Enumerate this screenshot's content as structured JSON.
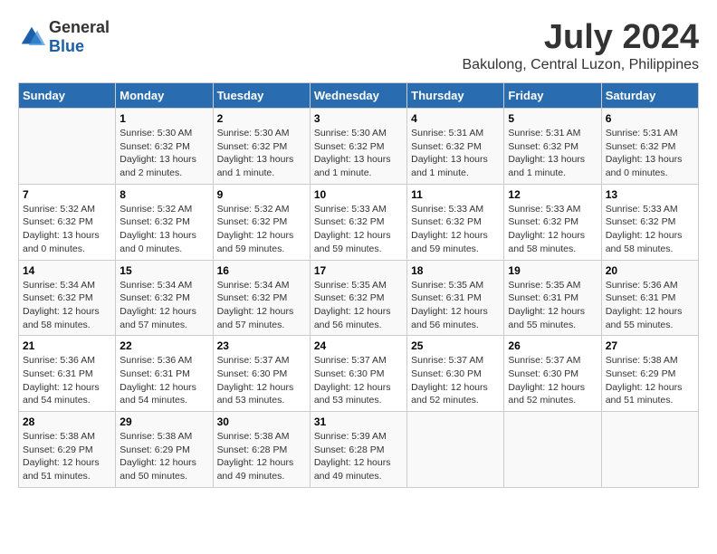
{
  "header": {
    "logo_general": "General",
    "logo_blue": "Blue",
    "title": "July 2024",
    "subtitle": "Bakulong, Central Luzon, Philippines"
  },
  "columns": [
    "Sunday",
    "Monday",
    "Tuesday",
    "Wednesday",
    "Thursday",
    "Friday",
    "Saturday"
  ],
  "weeks": [
    {
      "days": [
        {
          "num": "",
          "info": ""
        },
        {
          "num": "1",
          "info": "Sunrise: 5:30 AM\nSunset: 6:32 PM\nDaylight: 13 hours\nand 2 minutes."
        },
        {
          "num": "2",
          "info": "Sunrise: 5:30 AM\nSunset: 6:32 PM\nDaylight: 13 hours\nand 1 minute."
        },
        {
          "num": "3",
          "info": "Sunrise: 5:30 AM\nSunset: 6:32 PM\nDaylight: 13 hours\nand 1 minute."
        },
        {
          "num": "4",
          "info": "Sunrise: 5:31 AM\nSunset: 6:32 PM\nDaylight: 13 hours\nand 1 minute."
        },
        {
          "num": "5",
          "info": "Sunrise: 5:31 AM\nSunset: 6:32 PM\nDaylight: 13 hours\nand 1 minute."
        },
        {
          "num": "6",
          "info": "Sunrise: 5:31 AM\nSunset: 6:32 PM\nDaylight: 13 hours\nand 0 minutes."
        }
      ]
    },
    {
      "days": [
        {
          "num": "7",
          "info": "Sunrise: 5:32 AM\nSunset: 6:32 PM\nDaylight: 13 hours\nand 0 minutes."
        },
        {
          "num": "8",
          "info": "Sunrise: 5:32 AM\nSunset: 6:32 PM\nDaylight: 13 hours\nand 0 minutes."
        },
        {
          "num": "9",
          "info": "Sunrise: 5:32 AM\nSunset: 6:32 PM\nDaylight: 12 hours\nand 59 minutes."
        },
        {
          "num": "10",
          "info": "Sunrise: 5:33 AM\nSunset: 6:32 PM\nDaylight: 12 hours\nand 59 minutes."
        },
        {
          "num": "11",
          "info": "Sunrise: 5:33 AM\nSunset: 6:32 PM\nDaylight: 12 hours\nand 59 minutes."
        },
        {
          "num": "12",
          "info": "Sunrise: 5:33 AM\nSunset: 6:32 PM\nDaylight: 12 hours\nand 58 minutes."
        },
        {
          "num": "13",
          "info": "Sunrise: 5:33 AM\nSunset: 6:32 PM\nDaylight: 12 hours\nand 58 minutes."
        }
      ]
    },
    {
      "days": [
        {
          "num": "14",
          "info": "Sunrise: 5:34 AM\nSunset: 6:32 PM\nDaylight: 12 hours\nand 58 minutes."
        },
        {
          "num": "15",
          "info": "Sunrise: 5:34 AM\nSunset: 6:32 PM\nDaylight: 12 hours\nand 57 minutes."
        },
        {
          "num": "16",
          "info": "Sunrise: 5:34 AM\nSunset: 6:32 PM\nDaylight: 12 hours\nand 57 minutes."
        },
        {
          "num": "17",
          "info": "Sunrise: 5:35 AM\nSunset: 6:32 PM\nDaylight: 12 hours\nand 56 minutes."
        },
        {
          "num": "18",
          "info": "Sunrise: 5:35 AM\nSunset: 6:31 PM\nDaylight: 12 hours\nand 56 minutes."
        },
        {
          "num": "19",
          "info": "Sunrise: 5:35 AM\nSunset: 6:31 PM\nDaylight: 12 hours\nand 55 minutes."
        },
        {
          "num": "20",
          "info": "Sunrise: 5:36 AM\nSunset: 6:31 PM\nDaylight: 12 hours\nand 55 minutes."
        }
      ]
    },
    {
      "days": [
        {
          "num": "21",
          "info": "Sunrise: 5:36 AM\nSunset: 6:31 PM\nDaylight: 12 hours\nand 54 minutes."
        },
        {
          "num": "22",
          "info": "Sunrise: 5:36 AM\nSunset: 6:31 PM\nDaylight: 12 hours\nand 54 minutes."
        },
        {
          "num": "23",
          "info": "Sunrise: 5:37 AM\nSunset: 6:30 PM\nDaylight: 12 hours\nand 53 minutes."
        },
        {
          "num": "24",
          "info": "Sunrise: 5:37 AM\nSunset: 6:30 PM\nDaylight: 12 hours\nand 53 minutes."
        },
        {
          "num": "25",
          "info": "Sunrise: 5:37 AM\nSunset: 6:30 PM\nDaylight: 12 hours\nand 52 minutes."
        },
        {
          "num": "26",
          "info": "Sunrise: 5:37 AM\nSunset: 6:30 PM\nDaylight: 12 hours\nand 52 minutes."
        },
        {
          "num": "27",
          "info": "Sunrise: 5:38 AM\nSunset: 6:29 PM\nDaylight: 12 hours\nand 51 minutes."
        }
      ]
    },
    {
      "days": [
        {
          "num": "28",
          "info": "Sunrise: 5:38 AM\nSunset: 6:29 PM\nDaylight: 12 hours\nand 51 minutes."
        },
        {
          "num": "29",
          "info": "Sunrise: 5:38 AM\nSunset: 6:29 PM\nDaylight: 12 hours\nand 50 minutes."
        },
        {
          "num": "30",
          "info": "Sunrise: 5:38 AM\nSunset: 6:28 PM\nDaylight: 12 hours\nand 49 minutes."
        },
        {
          "num": "31",
          "info": "Sunrise: 5:39 AM\nSunset: 6:28 PM\nDaylight: 12 hours\nand 49 minutes."
        },
        {
          "num": "",
          "info": ""
        },
        {
          "num": "",
          "info": ""
        },
        {
          "num": "",
          "info": ""
        }
      ]
    }
  ]
}
